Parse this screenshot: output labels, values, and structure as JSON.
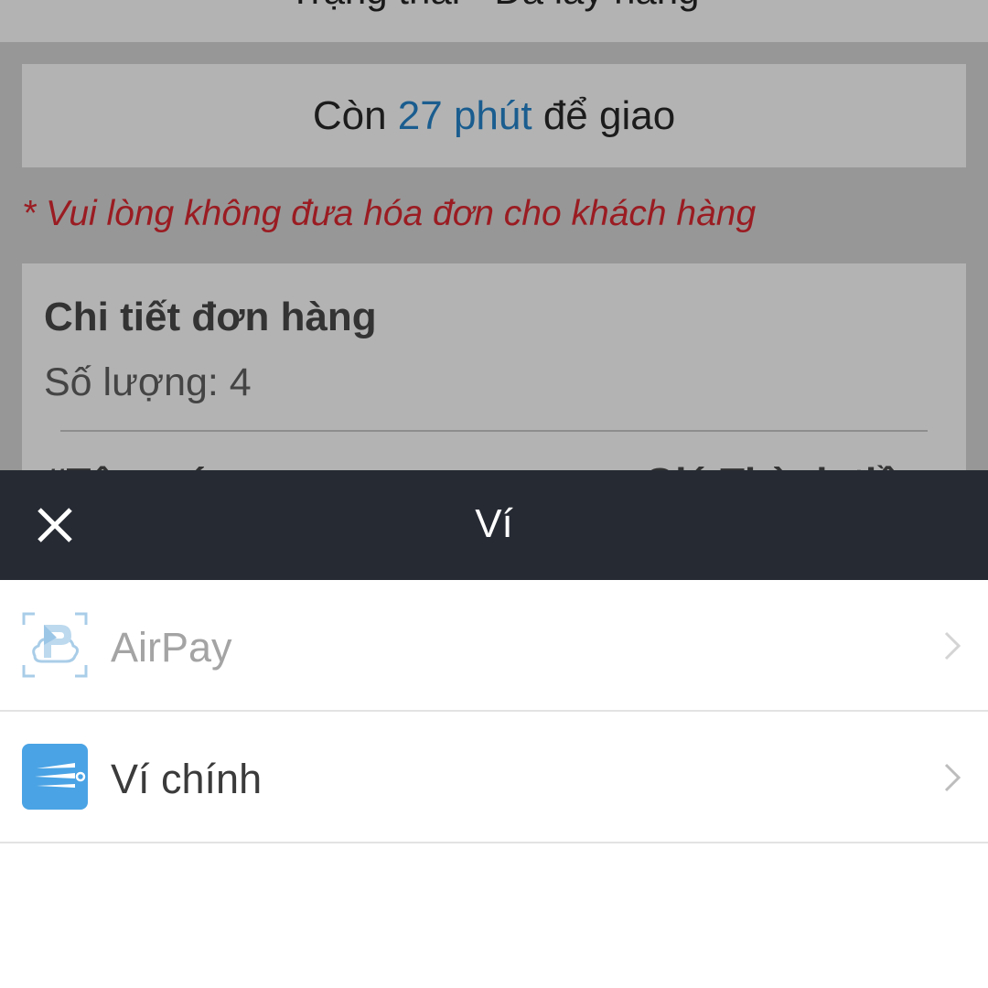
{
  "background_page": {
    "status_text": "Trạng thái - Đã lấy hàng",
    "countdown": {
      "prefix": "Còn ",
      "minutes": "27 phút",
      "suffix": " để giao"
    },
    "notice": "* Vui lòng không đưa hóa đơn cho khách hàng",
    "order_detail": {
      "title": "Chi tiết đơn hàng",
      "quantity_label": "Số lượng: 4",
      "cutoff_left": "#Tên món",
      "cutoff_right": "Giá Thành tiền"
    }
  },
  "sheet": {
    "title": "Ví",
    "close_icon": "close-icon",
    "items": [
      {
        "label": "AirPay",
        "icon": "airpay-logo-icon",
        "enabled": false,
        "chevron": "chevron-right-icon"
      },
      {
        "label": "Ví chính",
        "icon": "wallet-main-icon",
        "enabled": true,
        "chevron": "chevron-right-icon"
      }
    ]
  },
  "colors": {
    "overlay_bg": "#979797",
    "header_dark": "#262a33",
    "accent_blue": "#1a5d8f",
    "notice_red": "#9a1c22",
    "wallet_icon_blue": "#4aa3e4"
  }
}
